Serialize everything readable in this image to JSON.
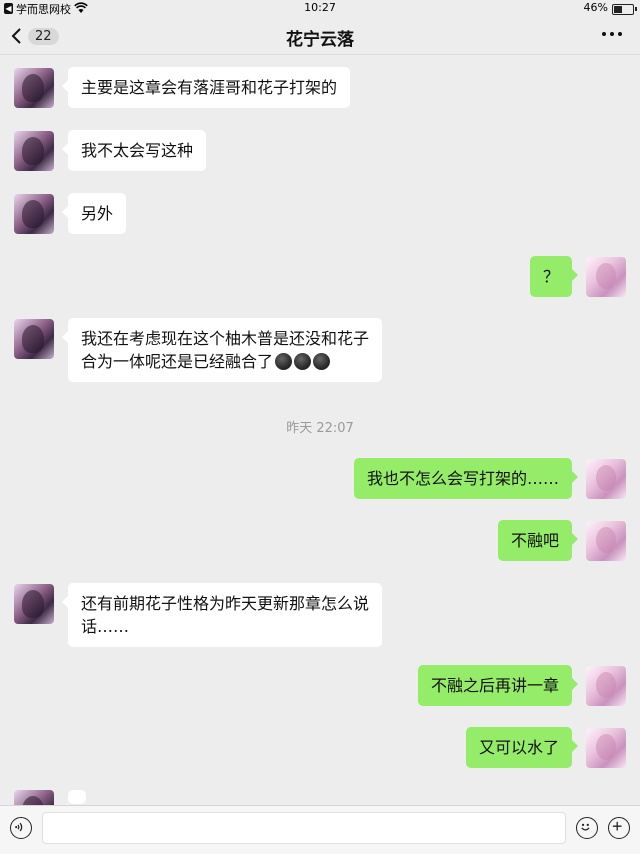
{
  "status_bar": {
    "back_app": "学而思网校",
    "time": "10:27",
    "battery": "46%",
    "battery_level": 0.46
  },
  "nav": {
    "unread_count": "22",
    "title": "花宁云落"
  },
  "messages": [
    {
      "side": "in",
      "text": "主要是这章会有落涯哥和花子打架的"
    },
    {
      "side": "in",
      "text": "我不太会写这种"
    },
    {
      "side": "in",
      "text": "另外"
    },
    {
      "side": "out",
      "text": "？"
    },
    {
      "side": "in",
      "text_line1": "我还在考虑现在这个柚木普是还没和花子",
      "text_line2": "合为一体呢还是已经融合了",
      "emojis": [
        "new-moon-face-icon",
        "new-moon-face-icon",
        "new-moon-face-icon"
      ]
    },
    {
      "side": "out",
      "text": "我也不怎么会写打架的……"
    },
    {
      "side": "out",
      "text": "不融吧"
    },
    {
      "side": "in",
      "text_line1": "还有前期花子性格为昨天更新那章怎么说",
      "text_line2": "话……"
    },
    {
      "side": "out",
      "text": "不融之后再讲一章"
    },
    {
      "side": "out",
      "text": "又可以水了"
    }
  ],
  "timestamp": "昨天 22:07",
  "input_bar": {
    "voice_icon": "voice-icon",
    "emoji_icon": "emoji-icon",
    "plus_icon": "plus-icon",
    "value": ""
  }
}
